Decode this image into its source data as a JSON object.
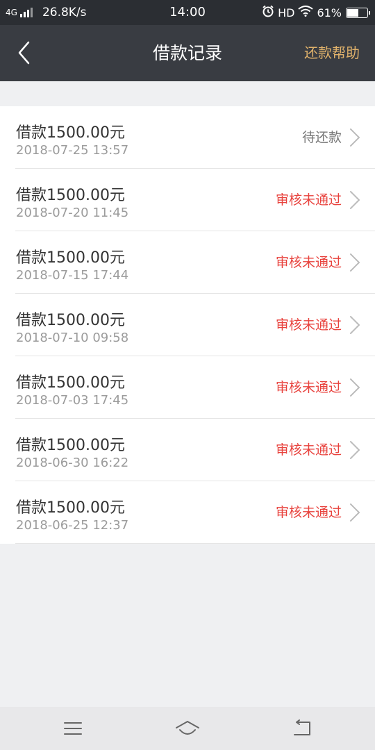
{
  "status_bar": {
    "network": "4G",
    "speed": "26.8K/s",
    "time": "14:00",
    "hd": "HD",
    "battery": "61%",
    "battery_level": 0.61
  },
  "header": {
    "title": "借款记录",
    "help_label": "还款帮助",
    "help_color": "#e0b26b"
  },
  "records": [
    {
      "amount": "借款1500.00元",
      "time": "2018-07-25 13:57",
      "status": "待还款",
      "status_type": "pending"
    },
    {
      "amount": "借款1500.00元",
      "time": "2018-07-20 11:45",
      "status": "审核未通过",
      "status_type": "rejected"
    },
    {
      "amount": "借款1500.00元",
      "time": "2018-07-15 17:44",
      "status": "审核未通过",
      "status_type": "rejected"
    },
    {
      "amount": "借款1500.00元",
      "time": "2018-07-10 09:58",
      "status": "审核未通过",
      "status_type": "rejected"
    },
    {
      "amount": "借款1500.00元",
      "time": "2018-07-03 17:45",
      "status": "审核未通过",
      "status_type": "rejected"
    },
    {
      "amount": "借款1500.00元",
      "time": "2018-06-30 16:22",
      "status": "审核未通过",
      "status_type": "rejected"
    },
    {
      "amount": "借款1500.00元",
      "time": "2018-06-25 12:37",
      "status": "审核未通过",
      "status_type": "rejected"
    }
  ],
  "colors": {
    "rejected": "#e8423d",
    "pending": "#777777",
    "nav_bg": "#393c42"
  },
  "icons": {
    "back": "chevron-left-icon",
    "row_arrow": "chevron-right-icon",
    "menu": "menu-icon",
    "home": "home-icon",
    "return": "return-icon"
  }
}
